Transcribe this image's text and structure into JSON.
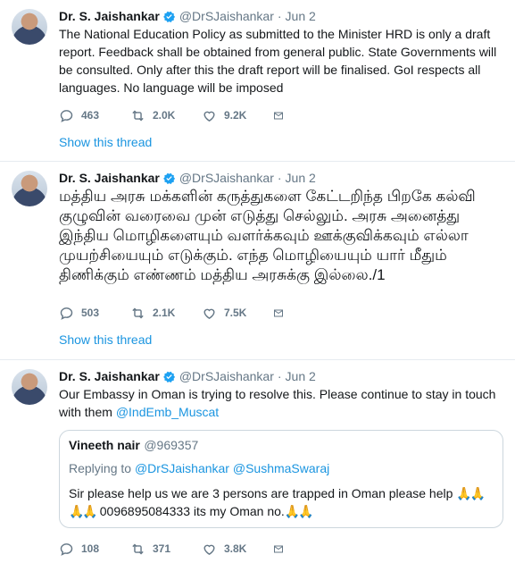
{
  "colors": {
    "accent": "#1b95e0",
    "muted": "#657786",
    "text": "#14171a",
    "border": "#e6ecf0",
    "verified": "#1da1f2"
  },
  "tweets": [
    {
      "name": "Dr. S. Jaishankar",
      "handle": "@DrSJaishankar",
      "dot": "·",
      "time": "Jun 2",
      "text": "The National Education Policy as submitted to the Minister HRD is only a draft report. Feedback shall be obtained from general public. State Governments will be consulted. Only after this the draft report will be finalised. GoI respects all languages. No language will be imposed",
      "replies": "463",
      "retweets": "2.0K",
      "likes": "9.2K",
      "show_thread": "Show this thread"
    },
    {
      "name": "Dr. S. Jaishankar",
      "handle": "@DrSJaishankar",
      "dot": "·",
      "time": "Jun 2",
      "text": "மத்திய அரசு மக்களின் கருத்துகளை கேட்டறிந்த பிறகே கல்வி குழுவின் வரைவை முன் எடுத்து செல்லும். அரசு அனைத்து இந்திய மொழிகளையும் வளர்க்கவும் ஊக்குவிக்கவும் எல்லா முயற்சியையும் எடுக்கும். எந்த மொழியையும் யார் மீதும் திணிக்கும் எண்ணம் மத்திய அரசுக்கு இல்லை./1",
      "replies": "503",
      "retweets": "2.1K",
      "likes": "7.5K",
      "show_thread": "Show this thread"
    },
    {
      "name": "Dr. S. Jaishankar",
      "handle": "@DrSJaishankar",
      "dot": "·",
      "time": "Jun 2",
      "text": "Our Embassy in Oman is trying to resolve this. Please continue to stay in touch with them ",
      "mention": "@IndEmb_Muscat",
      "quote": {
        "name": "Vineeth nair",
        "handle": "@969357",
        "replying_label": "Replying to ",
        "replying_to_1": "@DrSJaishankar",
        "replying_to_2": "@SushmaSwaraj",
        "text_1": "Sir please help us we are 3 persons are trapped in Oman please help ",
        "emoji": "🙏🙏",
        "text_2": " 0096895084333 its my Oman no."
      },
      "replies": "108",
      "retweets": "371",
      "likes": "3.8K"
    }
  ]
}
